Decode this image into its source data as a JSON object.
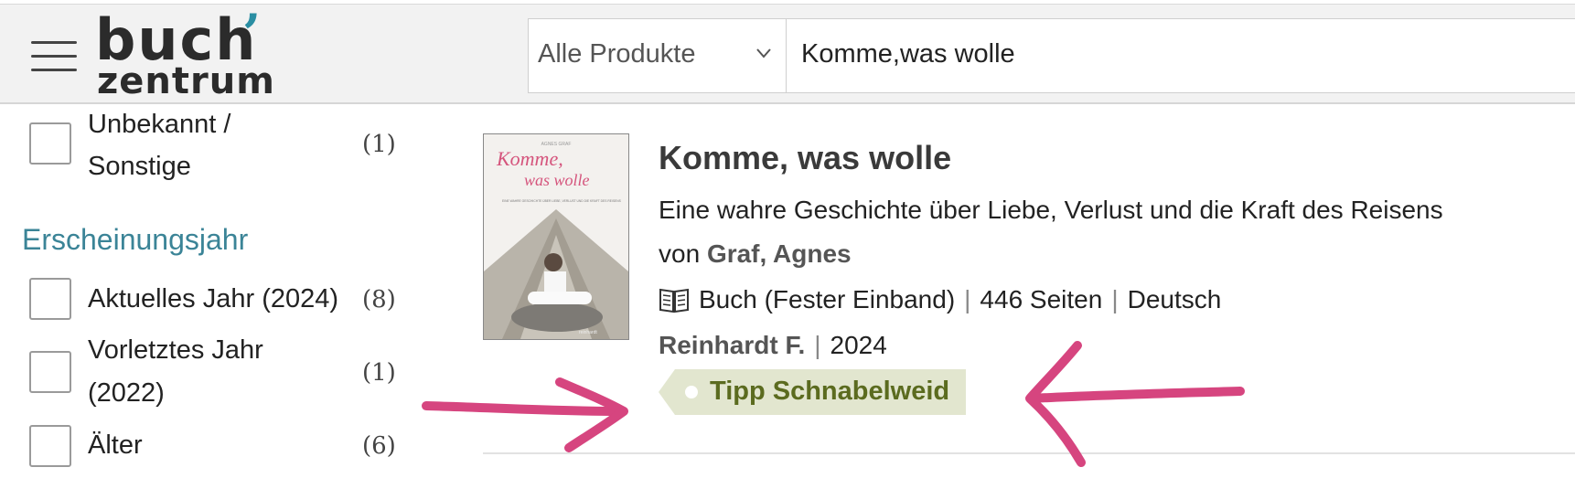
{
  "header": {
    "logo": {
      "line1": "buch",
      "line2": "zentrum"
    },
    "search": {
      "category": "Alle Produkte",
      "query": "Komme,was wolle"
    }
  },
  "filters": {
    "sprache_tail": {
      "label_line1": "Unbekannt /",
      "label_line2": "Sonstige",
      "count": "(1)"
    },
    "year_heading": "Erscheinungsjahr",
    "year_options": [
      {
        "label": "Aktuelles Jahr (2024)",
        "count": "(8)"
      },
      {
        "label_line1": "Vorletztes Jahr",
        "label_line2": "(2022)",
        "count": "(1)"
      },
      {
        "label": "Älter",
        "count": "(6)"
      }
    ]
  },
  "product": {
    "cover": {
      "small_author": "AGNES GRAF",
      "title_line1": "Komme,",
      "title_line2": "was wolle",
      "blurb": "EINE WAHRE GESCHICHTE ÜBER LIEBE, VERLUST UND DIE KRAFT DES REISENS",
      "publisher": "reinhardt"
    },
    "title": "Komme, was wolle",
    "subtitle": "Eine wahre Geschichte über Liebe, Verlust und die Kraft des Reisens",
    "author_prefix": "von",
    "author": "Graf, Agnes",
    "format": "Buch (Fester Einband)",
    "pages": "446 Seiten",
    "language": "Deutsch",
    "publisher": "Reinhardt F.",
    "year": "2024",
    "tag": "Tipp Schnabelweid",
    "icons": {
      "format_icon": "open-book-icon"
    }
  },
  "annotations": {
    "arrow_color": "#d6457f"
  }
}
